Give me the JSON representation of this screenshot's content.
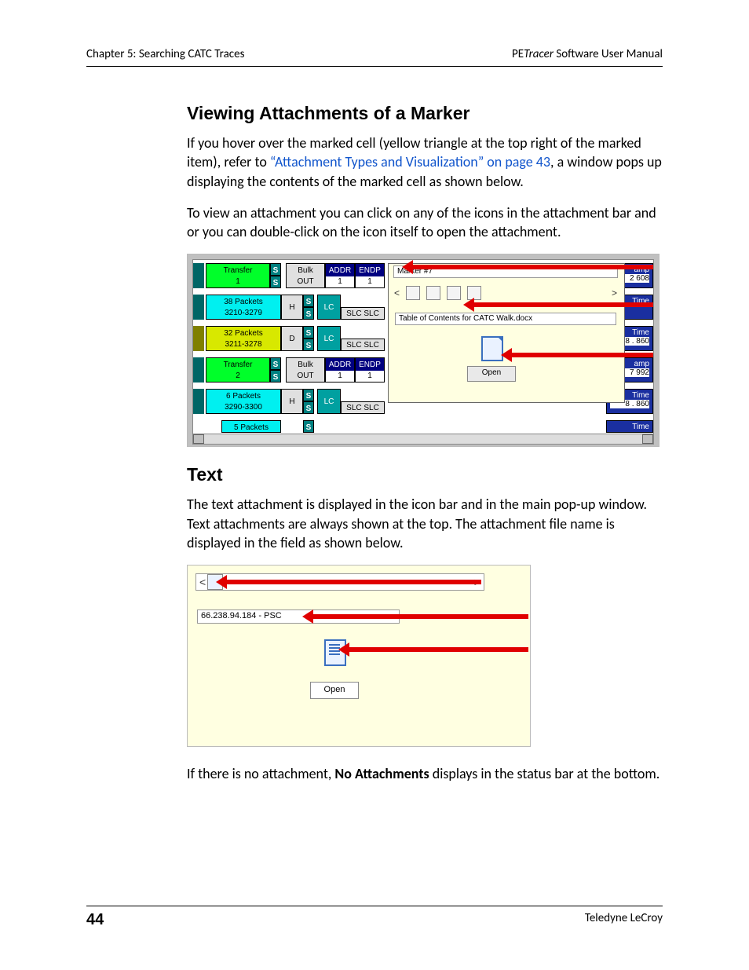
{
  "header": {
    "left": "Chapter 5: Searching CATC Traces",
    "right_prefix": "PE",
    "right_italic": "Tracer",
    "right_suffix": " Software User Manual"
  },
  "section1": {
    "heading": "Viewing Attachments of a Marker",
    "para1_a": "If you hover over the marked cell (yellow triangle at the top right of the marked item), refer to ",
    "para1_link": "“Attachment Types and Visualization” on page 43",
    "para1_b": ", a window pops up displaying the contents of the marked cell as shown below.",
    "para2": "To view an attachment you can click on any of the icons in the attachment bar and or you can double-click on the icon itself to open the attachment."
  },
  "fig1": {
    "rows": [
      {
        "left_label_a": "Transfer",
        "left_label_b": "1",
        "bulk_a": "Bulk",
        "bulk_b": "OUT",
        "addr_a": "ADDR",
        "addr_b": "1",
        "endp_a": "ENDP",
        "endp_b": "1"
      },
      {
        "left_label_a": "38 Packets",
        "left_label_b": "3210-3279",
        "dir": "H",
        "lc": "LC",
        "slc": "SLC SLC"
      },
      {
        "left_label_a": "32 Packets",
        "left_label_b": "3211-3278",
        "dir": "D",
        "lc": "LC",
        "slc": "SLC SLC"
      },
      {
        "left_label_a": "Transfer",
        "left_label_b": "2",
        "bulk_a": "Bulk",
        "bulk_b": "OUT",
        "addr_a": "ADDR",
        "addr_b": "1",
        "endp_a": "ENDP",
        "endp_b": "1"
      },
      {
        "left_label_a": "6 Packets",
        "left_label_b": "3290-3300",
        "dir": "H",
        "lc": "LC",
        "slc": "SLC SLC"
      },
      {
        "left_label_a": "5 Packets",
        "left_label_b": ""
      }
    ],
    "popup": {
      "marker_title": "Marker #7",
      "filename": "Table of Contents for CATC Walk.docx",
      "open_label": "Open"
    },
    "right_strip": [
      {
        "a": "amp",
        "b": "2 608",
        "cls": "navy"
      },
      {
        "a": "Time",
        "b": "",
        "cls": "navy"
      },
      {
        "a": "Time",
        "b": "8 . 860",
        "cls": "navy"
      },
      {
        "a": "amp",
        "b": "7 992",
        "cls": "navy"
      },
      {
        "a": "Time",
        "b": "8 . 860",
        "cls": "navy"
      },
      {
        "a": "Time",
        "b": "",
        "cls": "navy"
      }
    ]
  },
  "section2": {
    "heading": "Text",
    "para1": "The text attachment is displayed in the icon bar and in the main pop-up window. Text attachments are always shown at the top. The attachment file name is displayed in the field as shown below."
  },
  "fig2": {
    "filefield": "66.238.94.184 - PSC",
    "open_label": "Open"
  },
  "para_after_fig2_a": "If there is no attachment, ",
  "para_after_fig2_bold": "No Attachments",
  "para_after_fig2_b": " displays in the status bar at the bottom.",
  "footer": {
    "page": "44",
    "right": "Teledyne LeCroy"
  }
}
